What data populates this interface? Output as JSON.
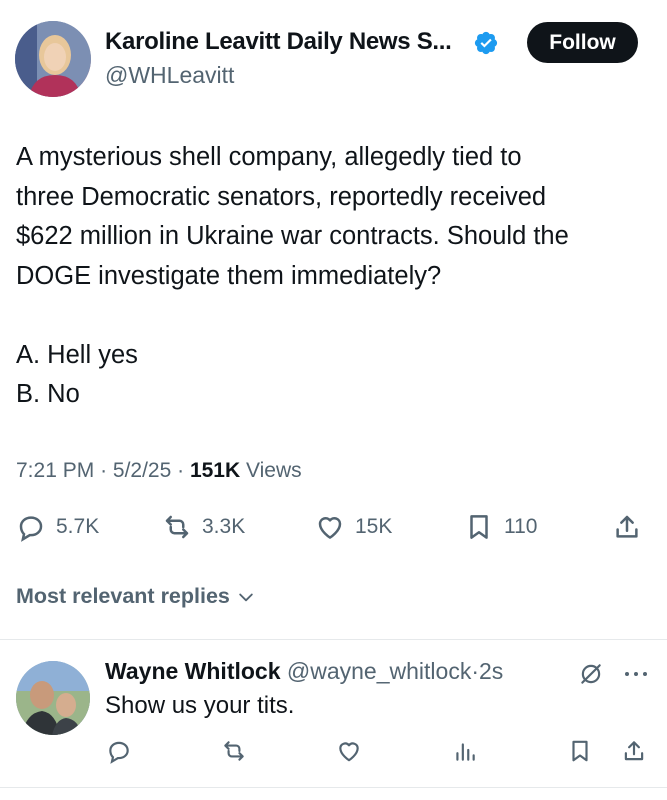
{
  "author": {
    "display_name": "Karoline Leavitt Daily News S...",
    "handle": "@WHLeavitt",
    "verified": true,
    "follow_label": "Follow"
  },
  "tweet": {
    "text": "A mysterious shell company, allegedly tied to\nthree Democratic senators, reportedly received\n$622 million in Ukraine war contracts. Should the\nDOGE investigate them immediately?\n\nA. Hell yes\nB. No",
    "time": "7:21 PM",
    "date": "5/2/25",
    "views_count": "151K",
    "views_label": "Views"
  },
  "actions": {
    "replies": "5.7K",
    "reposts": "3.3K",
    "likes": "15K",
    "bookmarks": "110"
  },
  "replies_sort": {
    "label": "Most relevant replies"
  },
  "reply": {
    "name": "Wayne Whitlock",
    "handle": "@wayne_whitlock",
    "time": "2s",
    "text": "Show us your tits."
  },
  "colors": {
    "text": "#0f1419",
    "secondary": "#536471",
    "verified": "#1d9bf0",
    "follow_bg": "#0f1419"
  }
}
